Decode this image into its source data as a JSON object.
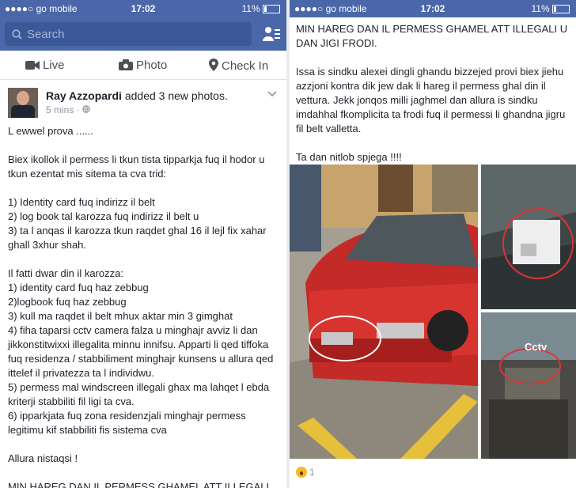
{
  "status": {
    "carrier": "●●●●○ go mobile",
    "time": "17:02",
    "battery": "11%"
  },
  "search": {
    "placeholder": "Search"
  },
  "actions": {
    "live": "Live",
    "photo": "Photo",
    "checkin": "Check In"
  },
  "post": {
    "author": "Ray Azzopardi",
    "action": "added 3 new photos.",
    "time": "5 mins · ",
    "left_text": "L ewwel prova ......\n\nBiex ikollok il permess li tkun tista tipparkja fuq il hodor u tkun ezentat mis sitema ta cva trid:\n\n1) Identity card fuq indirizz il belt\n2) log book tal karozza fuq indirizz il belt u\n3) ta l anqas il karozza tkun raqdet ghal 16 il lejl fix xahar ghall 3xhur shah.\n\nIl fatti dwar din il karozza:\n1) identity card fuq haz zebbug\n2)logbook fuq haz zebbug\n3) kull ma raqdet il belt mhux aktar min 3 gimghat\n4) fiha taparsi cctv camera falza u minghajr avviz li dan jikkonstitwixxi illegalita minnu innifsu. Apparti li qed tiffoka fuq residenza / stabbiliment  minghajr kunsens u allura qed ittelef il privatezza ta l individwu.\n5) permess mal windscreen illegali ghax ma lahqet l ebda kriterji stabbiliti fil ligi ta cva.\n6) ipparkjata fuq zona residenzjali minghajr permess legitimu kif stabbiliti fis sistema cva\n\nAllura nistaqsi !\n\nMIN HAREG DAN IL PERMESS GHAMEL ATT ILLEGALI",
    "right_text": "MIN HAREG DAN IL PERMESS GHAMEL ATT ILLEGALI U DAN JIGI FRODI.\n\nIssa is sindku alexei dingli ghandu bizzejed provi biex jiehu azzjoni kontra dik jew dak li hareg il permess ghal din il vettura. Jekk jonqos milli jaghmel dan allura is sindku imdahhal fkomplicita ta frodi fuq il permessi li ghandna jigru fil belt valletta.\n\nTa dan nitlob spjega !!!!",
    "photo_cctv_label": "Cctv",
    "reaction_count": "1"
  },
  "colors": {
    "fb_blue": "#4a67a9",
    "car_red": "#d8342f"
  }
}
